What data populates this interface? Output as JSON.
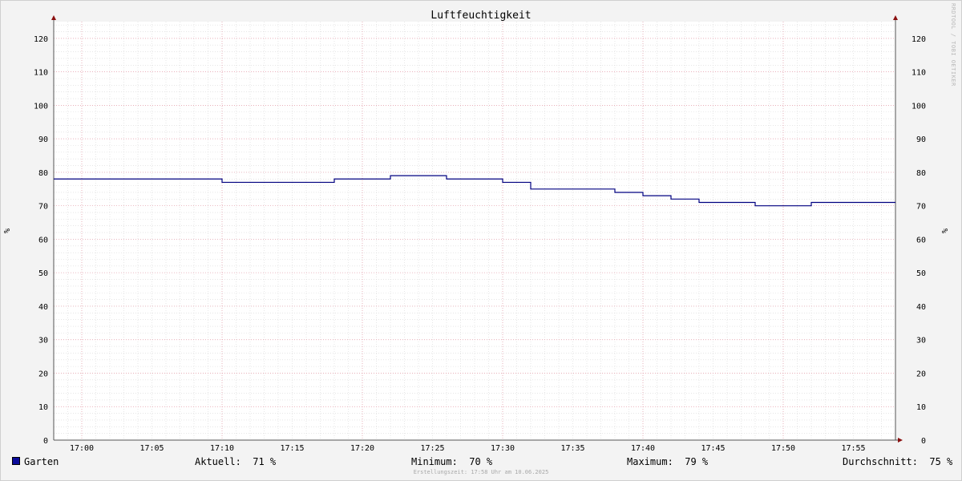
{
  "chart_data": {
    "type": "line",
    "title": "Luftfeuchtigkeit",
    "ylabel": "%",
    "ylabel_right": "%",
    "ylim": [
      0,
      125
    ],
    "yticks": [
      0,
      10,
      20,
      30,
      40,
      50,
      60,
      70,
      80,
      90,
      100,
      110,
      120
    ],
    "xlim": [
      "16:58",
      "17:58"
    ],
    "xticks": [
      "17:00",
      "17:05",
      "17:10",
      "17:15",
      "17:20",
      "17:25",
      "17:30",
      "17:35",
      "17:40",
      "17:45",
      "17:50",
      "17:55"
    ],
    "grid": true,
    "series": [
      {
        "name": "Garten",
        "color": "#000080",
        "step": true,
        "x": [
          "16:58",
          "17:10",
          "17:18",
          "17:22",
          "17:26",
          "17:30",
          "17:32",
          "17:38",
          "17:40",
          "17:42",
          "17:44",
          "17:48",
          "17:52"
        ],
        "values": [
          78,
          77,
          78,
          79,
          78,
          77,
          75,
          74,
          73,
          72,
          71,
          70,
          71
        ]
      }
    ]
  },
  "legend": {
    "series_name": "Garten",
    "series_color": "#0a0a9a",
    "current_label": "Aktuell:",
    "current_value": "71 %",
    "min_label": "Minimum:",
    "min_value": "70 %",
    "max_label": "Maximum:",
    "max_value": "79 %",
    "avg_label": "Durchschnitt:",
    "avg_value": "75 %"
  },
  "footer": "Erstellungszeit: 17:58 Uhr am 10.06.2025",
  "watermark": "RRDTOOL / TOBI OETIKER"
}
